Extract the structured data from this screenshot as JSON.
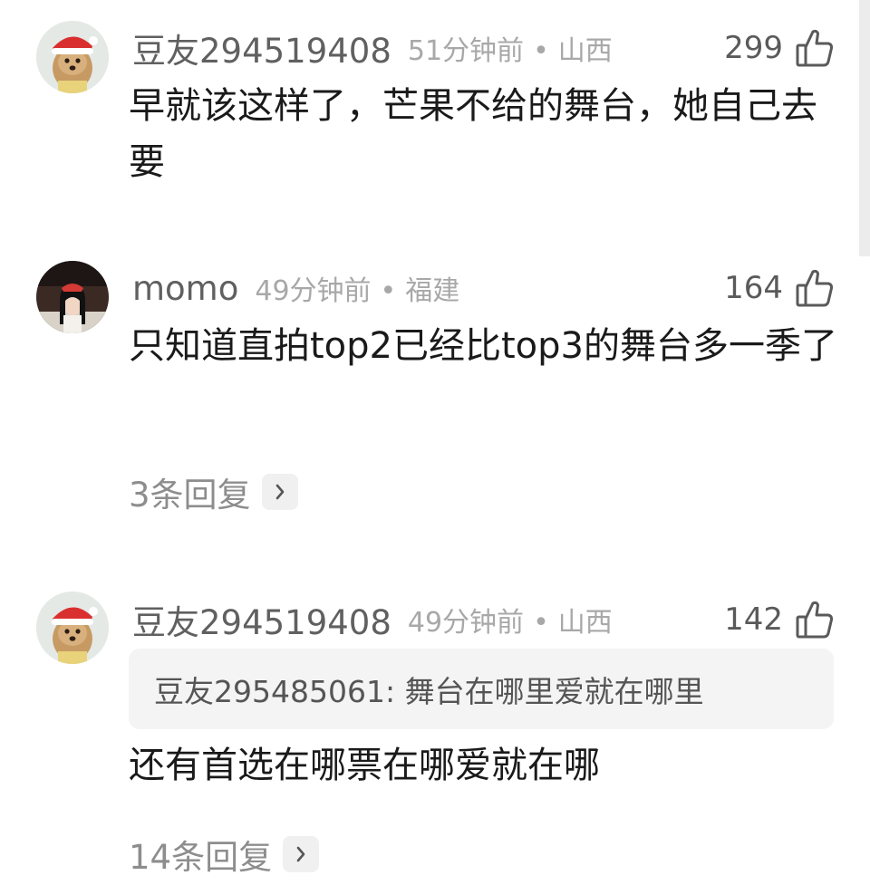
{
  "comments": [
    {
      "username": "豆友294519408",
      "time": "51分钟前",
      "separator": "•",
      "location": "山西",
      "likes": "299",
      "like_icon": "thumbs-up-icon",
      "avatar_icon": "dog-santa-hat-avatar",
      "text": "早就该这样了，芒果不给的舞台，她自己去要"
    },
    {
      "username": "momo",
      "time": "49分钟前",
      "separator": "•",
      "location": "福建",
      "likes": "164",
      "like_icon": "thumbs-up-icon",
      "avatar_icon": "girl-photo-avatar",
      "text": "只知道直拍top2已经比top3的舞台多一季了",
      "replies": "3条回复",
      "replies_icon": "chevron-right-icon"
    },
    {
      "username": "豆友294519408",
      "time": "49分钟前",
      "separator": "•",
      "location": "山西",
      "likes": "142",
      "like_icon": "thumbs-up-icon",
      "avatar_icon": "dog-santa-hat-avatar",
      "quote": "豆友295485061: 舞台在哪里爱就在哪里",
      "text": "还有首选在哪票在哪爱就在哪",
      "replies": "14条回复",
      "replies_icon": "chevron-right-icon"
    }
  ],
  "colors": {
    "username": "#606060",
    "meta": "#a8a8a8",
    "body_text": "#1a1a1a",
    "quote_bg": "#f4f4f4",
    "replies": "#8d8d8d"
  }
}
